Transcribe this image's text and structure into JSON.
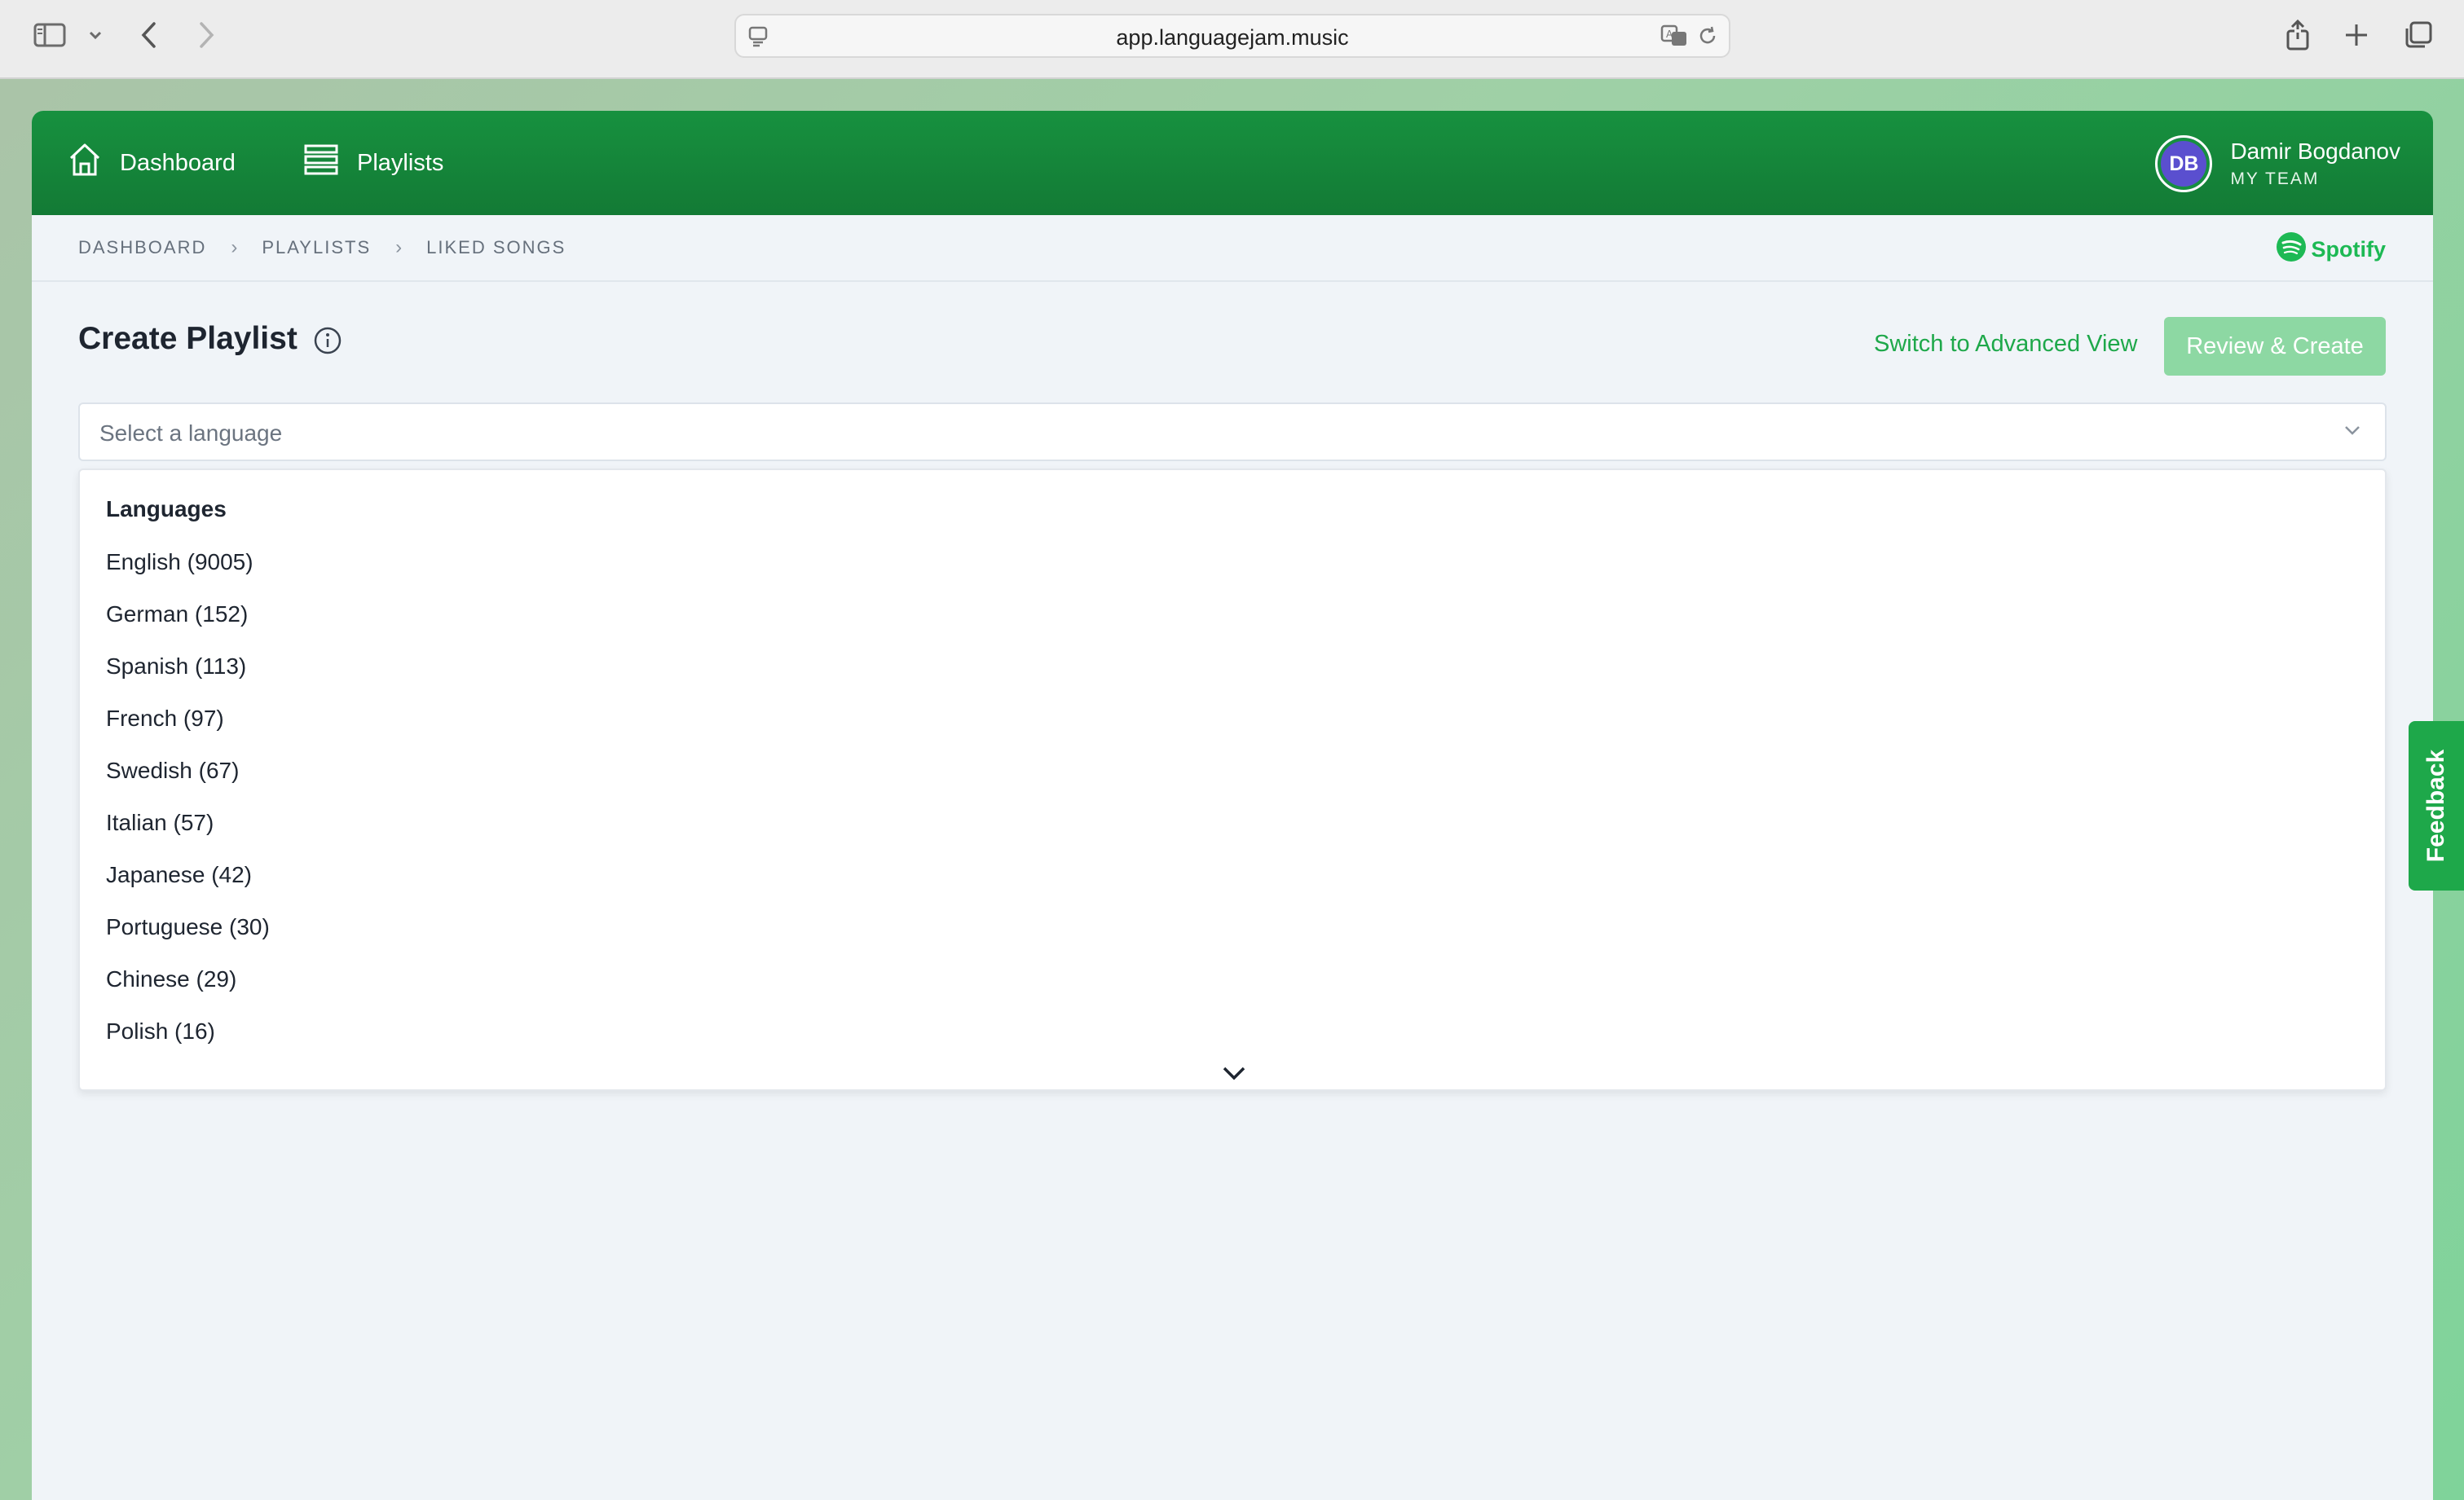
{
  "browser": {
    "url": "app.languagejam.music"
  },
  "nav": {
    "dashboard": "Dashboard",
    "playlists": "Playlists"
  },
  "user": {
    "initials": "DB",
    "name": "Damir Bogdanov",
    "team": "MY TEAM"
  },
  "breadcrumb": [
    "DASHBOARD",
    "PLAYLISTS",
    "LIKED SONGS"
  ],
  "brand": "Spotify",
  "page": {
    "title": "Create Playlist",
    "advanced_link": "Switch to Advanced View",
    "review_button": "Review & Create"
  },
  "language_select": {
    "placeholder": "Select a language",
    "group_header": "Languages",
    "options": [
      "English (9005)",
      "German (152)",
      "Spanish (113)",
      "French (97)",
      "Swedish (67)",
      "Italian (57)",
      "Japanese (42)",
      "Portuguese (30)",
      "Chinese (29)",
      "Polish (16)"
    ]
  },
  "feedback_label": "Feedback",
  "colors": {
    "brand_green": "#17913f",
    "accent_green": "#1ea84a",
    "disabled_button": "#8dd8a3",
    "avatar": "#5a4fcf",
    "spotify": "#1db954"
  },
  "icons": [
    "sidebar-icon",
    "chevron-down-icon",
    "back-icon",
    "forward-icon",
    "page-icon",
    "translate-icon",
    "reload-icon",
    "share-icon",
    "plus-icon",
    "tabs-icon",
    "home-icon",
    "list-icon",
    "info-icon",
    "spotify-icon"
  ]
}
